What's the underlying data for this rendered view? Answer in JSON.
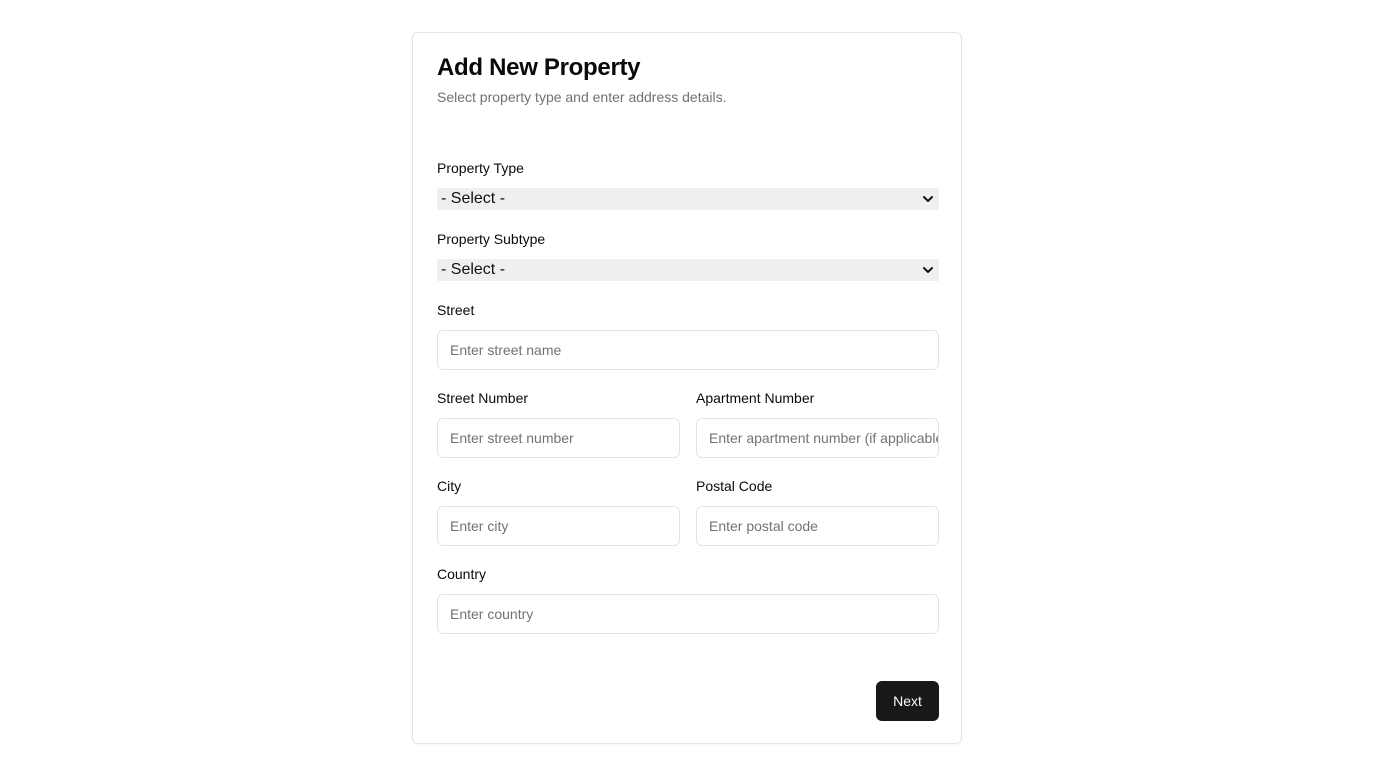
{
  "form": {
    "title": "Add New Property",
    "subtitle": "Select property type and enter address details.",
    "property_type": {
      "label": "Property Type",
      "value": "- Select -"
    },
    "property_subtype": {
      "label": "Property Subtype",
      "value": "- Select -"
    },
    "street": {
      "label": "Street",
      "placeholder": "Enter street name"
    },
    "street_number": {
      "label": "Street Number",
      "placeholder": "Enter street number"
    },
    "apartment_number": {
      "label": "Apartment Number",
      "placeholder": "Enter apartment number (if applicable)"
    },
    "city": {
      "label": "City",
      "placeholder": "Enter city"
    },
    "postal_code": {
      "label": "Postal Code",
      "placeholder": "Enter postal code"
    },
    "country": {
      "label": "Country",
      "placeholder": "Enter country"
    },
    "next_label": "Next"
  },
  "colors": {
    "primary_button": "#18181b",
    "border": "#e4e4e7",
    "muted_text": "#71717a",
    "select_bg": "#efefef"
  }
}
